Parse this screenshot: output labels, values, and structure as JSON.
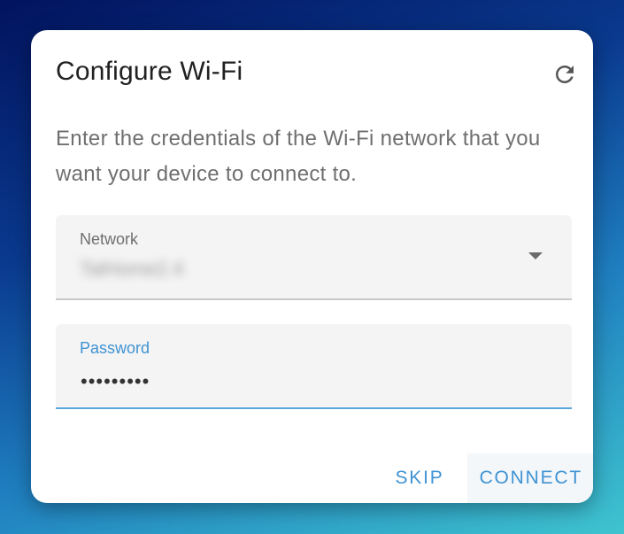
{
  "dialog": {
    "title": "Configure Wi-Fi",
    "description": "Enter the credentials of the Wi-Fi network that you want your device to connect to.",
    "refresh_icon": "refresh-icon"
  },
  "network_field": {
    "label": "Network",
    "value": "TalHome2.4",
    "dropdown_icon": "caret-down-icon"
  },
  "password_field": {
    "label": "Password",
    "value": "•••••••••"
  },
  "actions": {
    "skip_label": "SKIP",
    "connect_label": "CONNECT"
  },
  "colors": {
    "accent": "#3f93d3",
    "text_primary": "#212121",
    "text_secondary": "#6f6f6f",
    "field_background": "#f4f4f4"
  }
}
